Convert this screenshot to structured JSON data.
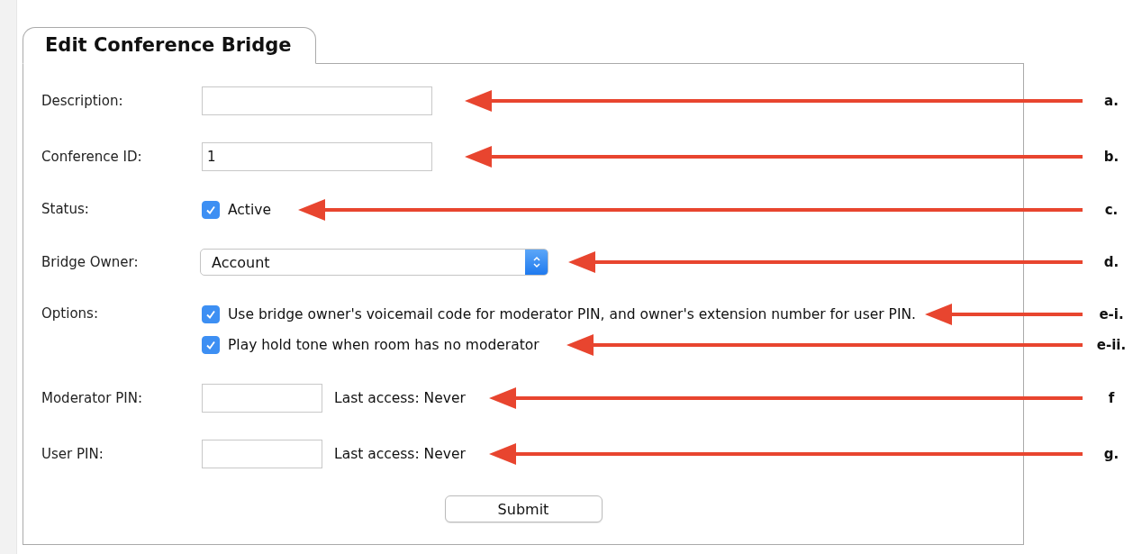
{
  "tab": {
    "title": "Edit Conference Bridge"
  },
  "form": {
    "rows": [
      {
        "kind": "text",
        "label": "Description:",
        "annotation": "a."
      },
      {
        "kind": "text",
        "label": "Conference ID:",
        "value": "1",
        "annotation": "b."
      },
      {
        "kind": "checkbox",
        "label": "Status:",
        "options": [
          {
            "text": "Active",
            "checked": true,
            "annotation": "c."
          }
        ]
      },
      {
        "kind": "select",
        "label": "Bridge Owner:",
        "value": "Account",
        "annotation": "d."
      },
      {
        "kind": "checkbox",
        "label": "Options:",
        "options": [
          {
            "text": "Use bridge owner's voicemail code for moderator PIN, and owner's extension number for user PIN.",
            "checked": true,
            "annotation": "e-i."
          },
          {
            "text": "Play hold tone when room has no moderator",
            "checked": true,
            "annotation": "e-ii."
          }
        ]
      },
      {
        "kind": "pin",
        "label": "Moderator PIN:",
        "note": "Last access: Never",
        "annotation": "f"
      },
      {
        "kind": "pin",
        "label": "User PIN:",
        "note": "Last access: Never",
        "annotation": "g."
      }
    ],
    "submit": "Submit"
  }
}
